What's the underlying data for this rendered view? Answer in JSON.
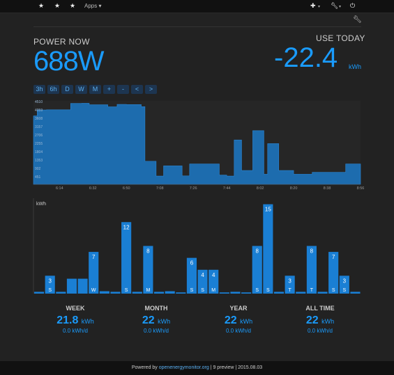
{
  "topbar": {
    "apps_label": "Apps",
    "icons": [
      "star-icon",
      "star-icon",
      "star-icon",
      "plus-icon",
      "wrench-icon",
      "power-icon"
    ]
  },
  "power_now": {
    "label": "POWER NOW",
    "value": "688W"
  },
  "use_today": {
    "label": "USE TODAY",
    "value": "-22.4",
    "unit": "kWh"
  },
  "range_buttons": [
    "3h",
    "6h",
    "D",
    "W",
    "M",
    "+",
    "-",
    "<",
    ">"
  ],
  "colors": {
    "accent": "#1a9bfc",
    "bar": "#1a7fd4",
    "power_fill": "#1d6cae",
    "background": "#222222"
  },
  "chart_data": [
    {
      "type": "area",
      "title": "",
      "y_ticks": [
        451,
        902,
        1353,
        1804,
        2255,
        2706,
        3157,
        3608,
        4059,
        4510
      ],
      "x_ticks": [
        "6:14",
        "6:32",
        "6:50",
        "7:08",
        "7:26",
        "7:44",
        "8:02",
        "8:20",
        "8:38",
        "8:56"
      ],
      "ylim": [
        0,
        4510
      ],
      "x": [
        "6:00",
        "6:02",
        "6:07",
        "6:20",
        "6:26",
        "6:30",
        "6:40",
        "6:45",
        "6:50",
        "6:58",
        "7:00",
        "7:06",
        "7:10",
        "7:16",
        "7:20",
        "7:24",
        "7:30",
        "7:40",
        "7:44",
        "7:48",
        "7:52",
        "7:58",
        "8:04",
        "8:06",
        "8:08",
        "8:12",
        "8:20",
        "8:30",
        "8:40",
        "8:48",
        "8:56"
      ],
      "y": [
        3700,
        4020,
        4030,
        4370,
        4380,
        4300,
        4190,
        4320,
        4310,
        4200,
        1250,
        450,
        1000,
        1000,
        460,
        1100,
        1100,
        500,
        450,
        2400,
        750,
        2900,
        550,
        2200,
        2200,
        750,
        550,
        650,
        650,
        1100,
        700
      ]
    },
    {
      "type": "bar",
      "ylabel": "kWh",
      "values": [
        0.3,
        3,
        0.3,
        2.5,
        2.5,
        7,
        0.4,
        0.3,
        12,
        0.3,
        8,
        0.3,
        0.4,
        0.2,
        6,
        4,
        4,
        0.2,
        0.3,
        0.2,
        8,
        15,
        0.3,
        3,
        0.3,
        8,
        0.3,
        7,
        3,
        0.3
      ],
      "value_labels": [
        "",
        "3",
        "",
        "",
        "",
        "7",
        "",
        "",
        "12",
        "",
        "8",
        "",
        "",
        "",
        "6",
        "4",
        "4",
        "",
        "",
        "",
        "8",
        "15",
        "",
        "3",
        "",
        "8",
        "",
        "7",
        "3",
        ""
      ],
      "day_labels": [
        "",
        "S",
        "",
        "",
        "",
        "W",
        "",
        "",
        "S",
        "",
        "M",
        "",
        "",
        "",
        "S",
        "S",
        "M",
        "",
        "",
        "",
        "S",
        "S",
        "",
        "T",
        "",
        "T",
        "",
        "S",
        "S",
        ""
      ]
    }
  ],
  "stats": [
    {
      "label": "WEEK",
      "value": "21.8",
      "unit": "kWh",
      "sub": "0.0 kWh/d"
    },
    {
      "label": "MONTH",
      "value": "22",
      "unit": "kWh",
      "sub": "0.0 kWh/d"
    },
    {
      "label": "YEAR",
      "value": "22",
      "unit": "kWh",
      "sub": "0.0 kWh/d"
    },
    {
      "label": "ALL TIME",
      "value": "22",
      "unit": "kWh",
      "sub": "0.0 kWh/d"
    }
  ],
  "footer": {
    "prefix": "Powered by ",
    "link": "openenergymonitor.org",
    "suffix": " | 9 preview | 2015.08.03"
  }
}
